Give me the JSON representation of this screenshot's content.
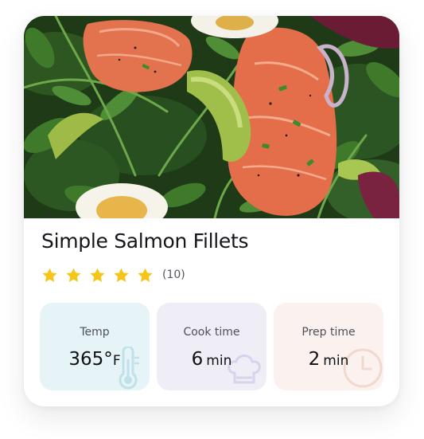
{
  "recipe": {
    "title": "Simple Salmon Fillets",
    "rating": {
      "stars": 5,
      "max_stars": 5,
      "count_text": "(10)",
      "star_color": "#F5C518"
    },
    "stats": [
      {
        "label": "Temp",
        "value": "365°",
        "unit": "F",
        "icon": "thermometer-icon",
        "bg": "#E7F4F7",
        "icon_color": "#BFE1EA"
      },
      {
        "label": "Cook time",
        "value": "6",
        "unit": "min",
        "icon": "chef-hat-icon",
        "bg": "#EFEEF7",
        "icon_color": "#D6D4EC"
      },
      {
        "label": "Prep time",
        "value": "2",
        "unit": "min",
        "icon": "clock-icon",
        "bg": "#FBF2EF",
        "icon_color": "#F2D9CF"
      }
    ]
  },
  "image": {
    "description_icon": "salmon-salad-photo"
  }
}
